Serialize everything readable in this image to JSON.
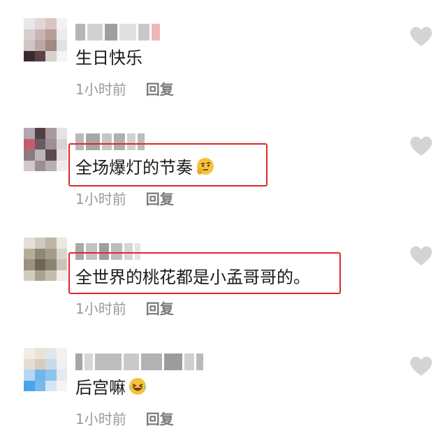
{
  "comments": [
    {
      "text": "生日快乐",
      "time": "1小时前",
      "reply_label": "回复",
      "emoji": "",
      "highlighted": false,
      "avatar_colors": [
        "#e8e8e8",
        "#e1d8d6",
        "#d9c4c0",
        "#f2f2f2",
        "#d6d0cf",
        "#c9b6b2",
        "#b89d97",
        "#ececec",
        "#cfc6c5",
        "#bba8a4",
        "#a08883",
        "#e2e2e2",
        "#3a2a2e",
        "#5a4247",
        "#d9d0d0",
        "#f4f4f4"
      ],
      "username_colors": [
        "#b5b5b5",
        "#d2d2d2",
        "#9f9f9f",
        "#e0e0e0",
        "#c8c8c8",
        "#f2b6b6"
      ]
    },
    {
      "text": "全场爆灯的节奏",
      "time": "1小时前",
      "reply_label": "回复",
      "emoji": "thinking-face",
      "highlighted": true,
      "avatar_colors": [
        "#b0a7b0",
        "#4f4046",
        "#a8999f",
        "#e7e2e4",
        "#c85b6a",
        "#6a5c63",
        "#9e8f95",
        "#d8d2d5",
        "#8c7b84",
        "#bfb5b9",
        "#5a4b52",
        "#e3dde0",
        "#d0c8cc",
        "#9b8e94",
        "#b8aeb3",
        "#f0eced"
      ],
      "username_colors": [
        "#b9b9b9",
        "#a7a7a7",
        "#c6c6c6",
        "#b0b0b0",
        "#d0d0d0",
        "#bcbcbc"
      ]
    },
    {
      "text": "全世界的桃花都是小孟哥哥的。",
      "time": "1小时前",
      "reply_label": "回复",
      "emoji": "",
      "highlighted": true,
      "avatar_colors": [
        "#e3e0d8",
        "#cfcabd",
        "#bdb6a6",
        "#ece9e2",
        "#b6ad99",
        "#8f8674",
        "#a59d8a",
        "#d9d5cb",
        "#9c927d",
        "#6f6656",
        "#8b8270",
        "#cbc5b8",
        "#d2ccc0",
        "#aaa290",
        "#c4bdad",
        "#f0eee9"
      ],
      "username_colors": [
        "#a9a9a9",
        "#c3c3c3",
        "#9e9e9e",
        "#bdbdbd",
        "#d5d5d5",
        "#e3e3e3"
      ]
    },
    {
      "text": "后宫嘛",
      "time": "1小时前",
      "reply_label": "回复",
      "emoji": "laughing-crying-face",
      "highlighted": false,
      "avatar_colors": [
        "#f1ece4",
        "#e9e2d6",
        "#dfe7ee",
        "#f4f1ec",
        "#e6ddd0",
        "#d8cdbd",
        "#c9dbe8",
        "#eef0f2",
        "#b7d6ef",
        "#6fb6ec",
        "#8cc4ee",
        "#e3eaf0",
        "#4aa4e8",
        "#76b9eb",
        "#d6e7f4",
        "#f3f5f7"
      ],
      "username_colors": [
        "#a6a6a6",
        "#d6d6d6",
        "#bdbdbd",
        "#c9c9c9",
        "#b2b2b2",
        "#9c9c9c",
        "#cfcfcf",
        "#bababa"
      ]
    }
  ],
  "colors": {
    "highlight": "#e0262d",
    "like_icon": "#d4d4d4",
    "meta_text": "#9a9a9a"
  }
}
